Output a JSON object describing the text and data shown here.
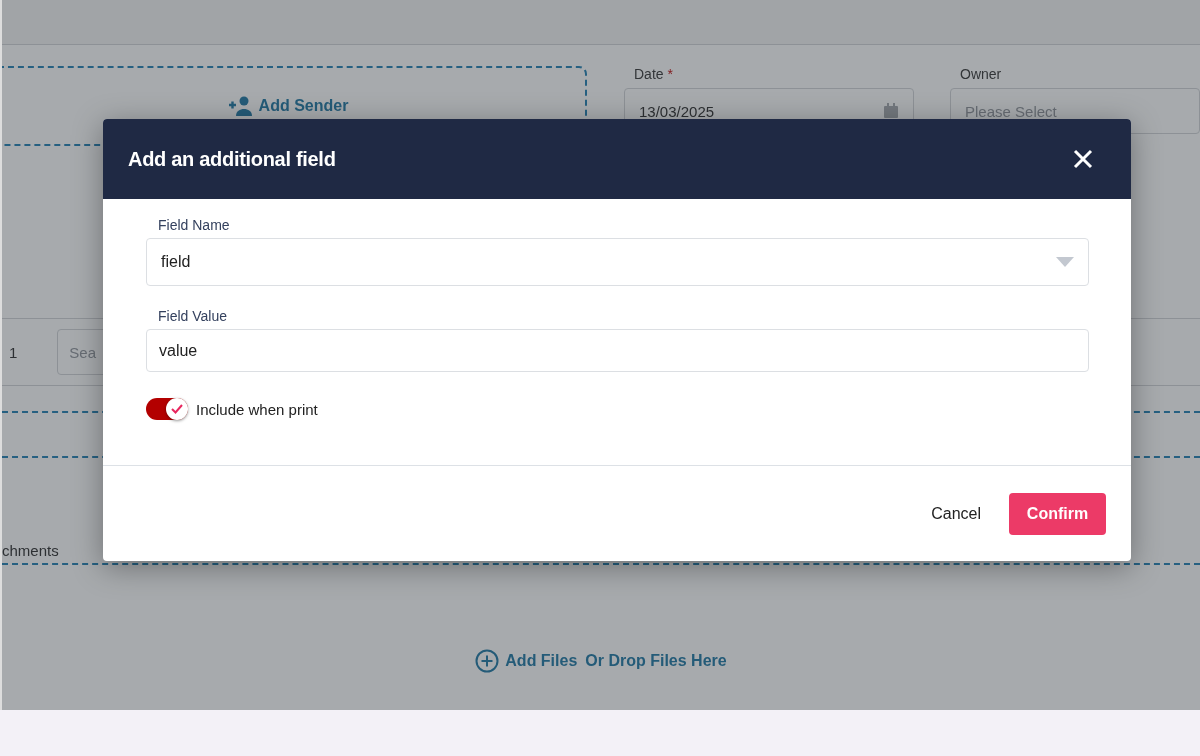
{
  "background": {
    "sender": {
      "label": "Add Sender"
    },
    "date": {
      "label": "Date",
      "required": "*",
      "value": "13/03/2025"
    },
    "owner": {
      "label": "Owner",
      "placeholder": "Please Select"
    },
    "row_number": "1",
    "search": {
      "placeholder": "Sea"
    },
    "attachments": {
      "label": "chments",
      "add_files": "Add Files",
      "drop_hint": "Or Drop Files Here"
    }
  },
  "dialog": {
    "title": "Add an additional field",
    "fields": [
      {
        "label": "Field Name",
        "value": "field",
        "kind": "select"
      },
      {
        "label": "Field Value",
        "value": "value",
        "kind": "text"
      }
    ],
    "include_when_print": {
      "label": "Include when print",
      "on": true
    },
    "buttons": [
      {
        "label": "Cancel",
        "kind": "text"
      },
      {
        "label": "Confirm",
        "kind": "primary"
      }
    ]
  }
}
